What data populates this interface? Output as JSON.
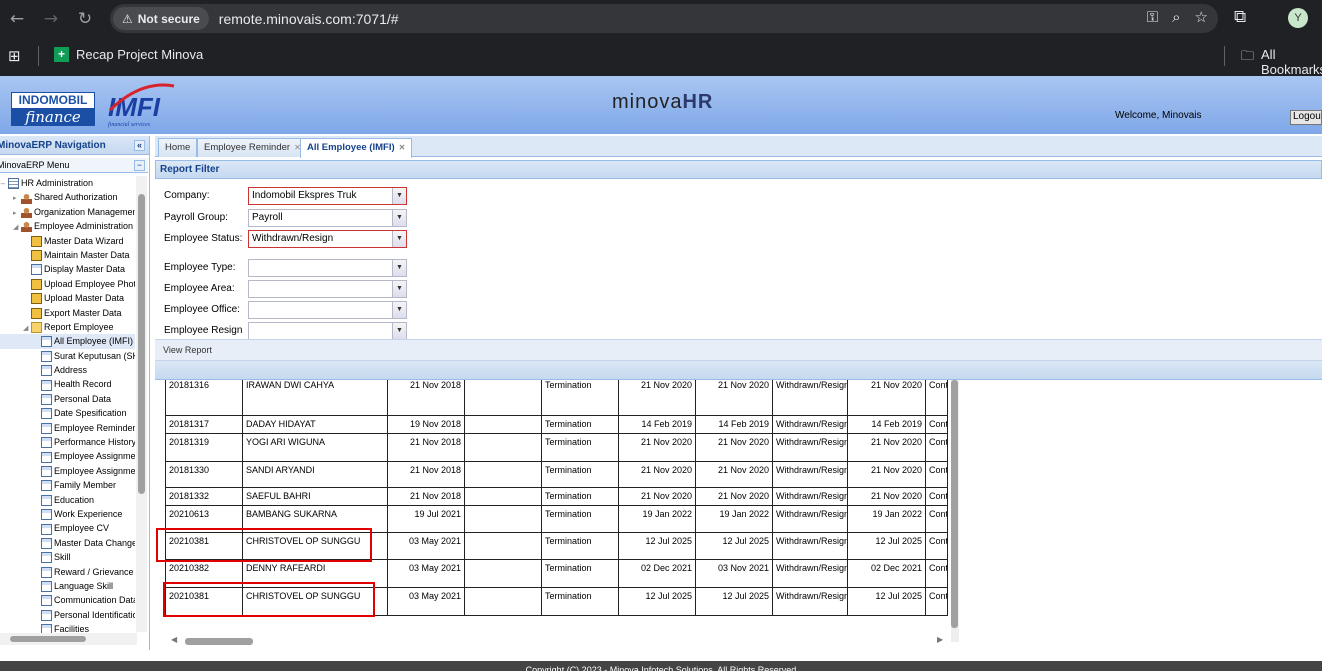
{
  "browser": {
    "security_label": "Not secure",
    "url": "remote.minovais.com:7071/#",
    "bookmark_label": "Recap Project Minova",
    "all_bookmarks_label": "All Bookmarks",
    "profile_initial": "Y"
  },
  "header": {
    "logo_text": "INDOMOBIL",
    "logo_sub": "finance",
    "logo2_text": "IMFI",
    "logo2_sub": "financial services",
    "brand_left": "minova",
    "brand_right": "HR",
    "welcome": "Welcome, Minovais",
    "logout": "Logout"
  },
  "sidebar": {
    "title": "MinovaERP Navigation",
    "menu_title": "MinovaERP Menu",
    "items": [
      {
        "label": "HR Administration",
        "icon": "grid-icon",
        "level": 0,
        "arrow": "−"
      },
      {
        "label": "Shared Authorization",
        "icon": "user-icon",
        "level": 1,
        "arrow": "▸"
      },
      {
        "label": "Organization Management",
        "icon": "user-icon",
        "level": 1,
        "arrow": "▸"
      },
      {
        "label": "Employee Administration",
        "icon": "user-icon",
        "level": 1,
        "arrow": "◢"
      },
      {
        "label": "Master Data Wizard",
        "icon": "edit-icon",
        "level": 2,
        "arrow": ""
      },
      {
        "label": "Maintain Master Data",
        "icon": "edit-icon",
        "level": 2,
        "arrow": ""
      },
      {
        "label": "Display Master Data",
        "icon": "doc-icon",
        "level": 2,
        "arrow": ""
      },
      {
        "label": "Upload Employee Photo",
        "icon": "edit-icon",
        "level": 2,
        "arrow": ""
      },
      {
        "label": "Upload Master Data",
        "icon": "edit-icon",
        "level": 2,
        "arrow": ""
      },
      {
        "label": "Export Master Data",
        "icon": "edit-icon",
        "level": 2,
        "arrow": ""
      },
      {
        "label": "Report Employee",
        "icon": "folder-icon",
        "level": 2,
        "arrow": "◢"
      },
      {
        "label": "All Employee (IMFI)",
        "icon": "report-icon",
        "level": 3,
        "arrow": "",
        "selected": true
      },
      {
        "label": "Surat Keputusan (SK)",
        "icon": "report-icon",
        "level": 3,
        "arrow": ""
      },
      {
        "label": "Address",
        "icon": "report-icon",
        "level": 3,
        "arrow": ""
      },
      {
        "label": "Health Record",
        "icon": "report-icon",
        "level": 3,
        "arrow": ""
      },
      {
        "label": "Personal Data",
        "icon": "report-icon",
        "level": 3,
        "arrow": ""
      },
      {
        "label": "Date Spesification",
        "icon": "report-icon",
        "level": 3,
        "arrow": ""
      },
      {
        "label": "Employee Reminder",
        "icon": "report-icon",
        "level": 3,
        "arrow": ""
      },
      {
        "label": "Performance History",
        "icon": "report-icon",
        "level": 3,
        "arrow": ""
      },
      {
        "label": "Employee Assignment",
        "icon": "report-icon",
        "level": 3,
        "arrow": ""
      },
      {
        "label": "Employee Assignment",
        "icon": "report-icon",
        "level": 3,
        "arrow": ""
      },
      {
        "label": "Family Member",
        "icon": "report-icon",
        "level": 3,
        "arrow": ""
      },
      {
        "label": "Education",
        "icon": "report-icon",
        "level": 3,
        "arrow": ""
      },
      {
        "label": "Work Experience",
        "icon": "report-icon",
        "level": 3,
        "arrow": ""
      },
      {
        "label": "Employee CV",
        "icon": "report-icon",
        "level": 3,
        "arrow": ""
      },
      {
        "label": "Master Data Change",
        "icon": "report-icon",
        "level": 3,
        "arrow": ""
      },
      {
        "label": "Skill",
        "icon": "report-icon",
        "level": 3,
        "arrow": ""
      },
      {
        "label": "Reward / Grievance",
        "icon": "report-icon",
        "level": 3,
        "arrow": ""
      },
      {
        "label": "Language Skill",
        "icon": "report-icon",
        "level": 3,
        "arrow": ""
      },
      {
        "label": "Communication Data",
        "icon": "report-icon",
        "level": 3,
        "arrow": ""
      },
      {
        "label": "Personal Identification",
        "icon": "report-icon",
        "level": 3,
        "arrow": ""
      },
      {
        "label": "Facilities",
        "icon": "report-icon",
        "level": 3,
        "arrow": ""
      }
    ]
  },
  "tabs": [
    {
      "label": "Home",
      "closable": false,
      "active": false
    },
    {
      "label": "Employee Reminder",
      "closable": true,
      "active": false
    },
    {
      "label": "All Employee (IMFI)",
      "closable": true,
      "active": true
    }
  ],
  "filter": {
    "title": "Report Filter",
    "fields": [
      {
        "label": "Company:",
        "value": "Indomobil Ekspres Truk",
        "required": true
      },
      {
        "label": "Payroll Group:",
        "value": "Payroll",
        "required": false
      },
      {
        "label": "Employee Status:",
        "value": "Withdrawn/Resign",
        "required": true
      },
      {
        "label": "Employee Type:",
        "value": "",
        "required": false
      },
      {
        "label": "Employee Area:",
        "value": "",
        "required": false
      },
      {
        "label": "Employee Office:",
        "value": "",
        "required": false
      },
      {
        "label": "Employee Resign",
        "value": "",
        "required": false
      }
    ],
    "view_report": "View Report"
  },
  "grid": {
    "rows": [
      [
        "20181316",
        "IRAWAN DWI CAHYA",
        "21 Nov 2018",
        "",
        "Termination",
        "21 Nov 2020",
        "21 Nov 2020",
        "Withdrawn/Resign",
        "21 Nov 2020",
        "Cont"
      ],
      [
        "20181317",
        "DADAY HIDAYAT",
        "19 Nov 2018",
        "",
        "Termination",
        "14 Feb 2019",
        "14 Feb 2019",
        "Withdrawn/Resign",
        "14 Feb 2019",
        "Cont"
      ],
      [
        "20181319",
        "YOGI ARI WIGUNA",
        "21 Nov 2018",
        "",
        "Termination",
        "21 Nov 2020",
        "21 Nov 2020",
        "Withdrawn/Resign",
        "21 Nov 2020",
        "Cont"
      ],
      [
        "20181330",
        "SANDI ARYANDI",
        "21 Nov 2018",
        "",
        "Termination",
        "21 Nov 2020",
        "21 Nov 2020",
        "Withdrawn/Resign",
        "21 Nov 2020",
        "Cont"
      ],
      [
        "20181332",
        "SAEFUL BAHRI",
        "21 Nov 2018",
        "",
        "Termination",
        "21 Nov 2020",
        "21 Nov 2020",
        "Withdrawn/Resign",
        "21 Nov 2020",
        "Cont"
      ],
      [
        "20210613",
        "BAMBANG SUKARNA",
        "19 Jul 2021",
        "",
        "Termination",
        "19 Jan 2022",
        "19 Jan 2022",
        "Withdrawn/Resign",
        "19 Jan 2022",
        "Cont"
      ],
      [
        "20210381",
        "CHRISTOVEL OP SUNGGU",
        "03 May 2021",
        "",
        "Termination",
        "12 Jul 2025",
        "12 Jul 2025",
        "Withdrawn/Resign",
        "12 Jul 2025",
        "Cont"
      ],
      [
        "20210382",
        "DENNY RAFEARDI",
        "03 May 2021",
        "",
        "Termination",
        "02 Dec 2021",
        "03 Nov 2021",
        "Withdrawn/Resign",
        "02 Dec 2021",
        "Cont"
      ],
      [
        "20210381",
        "CHRISTOVEL OP SUNGGU",
        "03 May 2021",
        "",
        "Termination",
        "12 Jul 2025",
        "12 Jul 2025",
        "Withdrawn/Resign",
        "12 Jul 2025",
        "Cont"
      ]
    ]
  },
  "footer": "Copyright (C) 2023 - Minova Infotech Solutions. All Rights Reserved"
}
